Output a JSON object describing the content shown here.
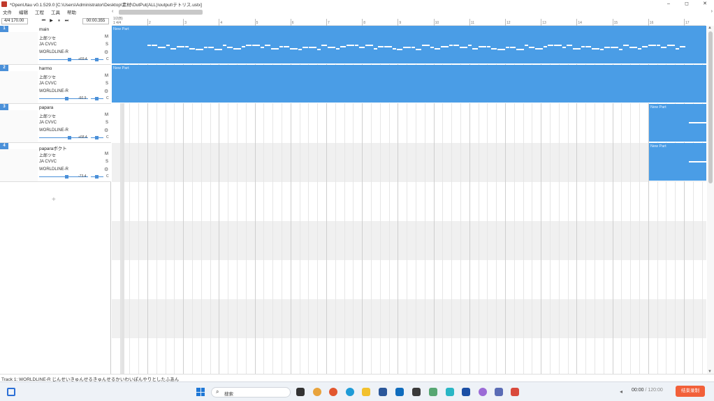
{
  "window": {
    "title": "*OpenUtau v0.1.529.0 [C:\\Users\\Administrator\\Desktop\\素材\\OutPut(ALL)\\output\\テトリス.ustx]",
    "minimize": "–",
    "maximize": "◻",
    "close": "✕"
  },
  "menu": [
    "文件",
    "编辑",
    "工程",
    "工具",
    "帮助"
  ],
  "transport": {
    "signature_tempo": "4/4   170.00",
    "time": "00:00.355",
    "buttons": [
      "⏮",
      "▶",
      "⏸",
      "⏭"
    ]
  },
  "ruler": {
    "top_label": "1/2(B)",
    "sig_label": "1 4/4",
    "bars": [
      "2",
      "3",
      "4",
      "5",
      "6",
      "7",
      "8",
      "9",
      "10",
      "11",
      "12",
      "13",
      "14",
      "15",
      "16",
      "17"
    ]
  },
  "tracks": [
    {
      "num": "1",
      "name": "main",
      "singer": "上郎ツセ",
      "phonemizer": "JA CVVC",
      "renderer": "WORLDLINE-R",
      "mute": "M",
      "solo": "S",
      "volume": "+69.4",
      "pan": "C",
      "volume_level": 0.62
    },
    {
      "num": "2",
      "name": "harmo",
      "singer": "上郎ツセ",
      "phonemizer": "JA CVVC",
      "renderer": "WORLDLINE-R",
      "mute": "M",
      "solo": "S",
      "volume": "-60.9",
      "pan": "C",
      "volume_level": 0.55
    },
    {
      "num": "3",
      "name": "papara",
      "singer": "上郎ツセ",
      "phonemizer": "JA CVVC",
      "renderer": "WORLDLINE-R",
      "mute": "M",
      "solo": "S",
      "volume": "+68.4",
      "pan": "C",
      "volume_level": 0.62
    },
    {
      "num": "4",
      "name": "paparaボクト",
      "singer": "上郎ツセ",
      "phonemizer": "JA CVVC",
      "renderer": "WORLDLINE-R",
      "mute": "M",
      "solo": "S",
      "volume": "-73.4",
      "pan": "C",
      "volume_level": 0.55
    }
  ],
  "add_track": "+",
  "parts": [
    {
      "label": "New Part"
    },
    {
      "label": "New Part"
    },
    {
      "label": "New Part"
    },
    {
      "label": "New Part"
    }
  ],
  "status": "Track 1: WORLDLINE-R じんせいきゅんせるきゅんせるかいわいぽんやりとしたふあん",
  "taskbar": {
    "search_placeholder": "搜索",
    "rec_time": "00:00",
    "rec_total": "/ 120:00",
    "rec_button": "结束录制"
  },
  "colors": {
    "part": "#4a9de6",
    "track_badge": "#4a90d9",
    "rec_button": "#f2603a"
  }
}
